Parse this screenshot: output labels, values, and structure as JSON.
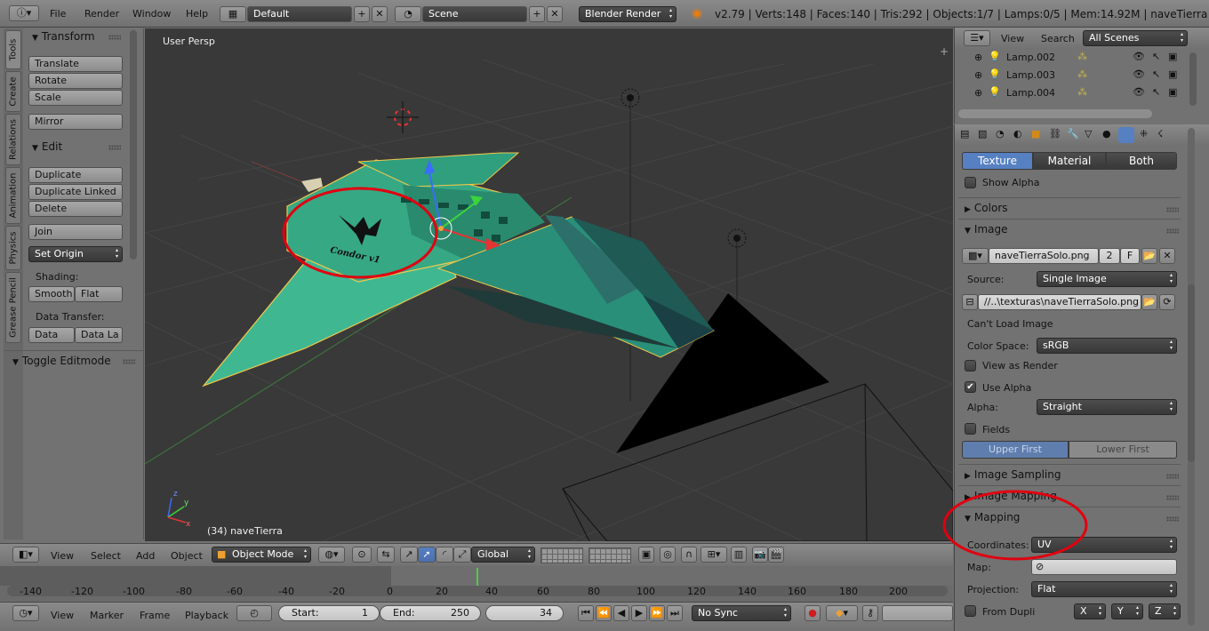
{
  "topbar": {
    "menus": [
      "File",
      "Render",
      "Window",
      "Help"
    ],
    "layout": "Default",
    "scene": "Scene",
    "engine": "Blender Render",
    "info": "v2.79 | Verts:148 | Faces:140 | Tris:292 | Objects:1/7 | Lamps:0/5 | Mem:14.92M | naveTierra"
  },
  "tabs": [
    "Tools",
    "Create",
    "Relations",
    "Animation",
    "Physics",
    "Grease Pencil"
  ],
  "toolshelf": {
    "transform_title": "Transform",
    "translate": "Translate",
    "rotate": "Rotate",
    "scale": "Scale",
    "mirror": "Mirror",
    "edit_title": "Edit",
    "duplicate": "Duplicate",
    "duplicate_linked": "Duplicate Linked",
    "delete": "Delete",
    "join": "Join",
    "set_origin": "Set Origin",
    "shading_label": "Shading:",
    "smooth": "Smooth",
    "flat": "Flat",
    "data_transfer_label": "Data Transfer:",
    "data": "Data",
    "data_la": "Data La",
    "toggle_editmode": "Toggle Editmode"
  },
  "viewport": {
    "view_name": "User Persp",
    "object_label": "(34) naveTierra",
    "decal_text": "Condor v1"
  },
  "vp_header": {
    "menus": [
      "View",
      "Select",
      "Add",
      "Object"
    ],
    "mode": "Object Mode",
    "orientation": "Global"
  },
  "timeline": {
    "ticks": [
      "-140",
      "-120",
      "-100",
      "-80",
      "-60",
      "-40",
      "-20",
      "0",
      "20",
      "40",
      "60",
      "80",
      "100",
      "120",
      "140",
      "160",
      "180",
      "200"
    ],
    "current_frame_marker": 34
  },
  "tl_header": {
    "menus": [
      "View",
      "Marker",
      "Frame",
      "Playback"
    ],
    "start_label": "Start:",
    "start": "1",
    "end_label": "End:",
    "end": "250",
    "current": "34",
    "sync": "No Sync"
  },
  "outliner": {
    "view": "View",
    "search": "Search",
    "filter": "All Scenes",
    "items": [
      "Lamp.002",
      "Lamp.003",
      "Lamp.004"
    ]
  },
  "props": {
    "tabs": [
      "Texture",
      "Material",
      "Both"
    ],
    "show_alpha": "Show Alpha",
    "colors_panel": "Colors",
    "image_panel": "Image",
    "image_name": "naveTierraSolo.png",
    "users": "2",
    "fake": "F",
    "source_label": "Source:",
    "source": "Single Image",
    "filepath": "//..\\texturas\\naveTierraSolo.png",
    "cant_load": "Can't Load Image",
    "color_space_label": "Color Space:",
    "color_space": "sRGB",
    "view_as_render": "View as Render",
    "use_alpha": "Use Alpha",
    "alpha_label": "Alpha:",
    "alpha": "Straight",
    "fields": "Fields",
    "upper_first": "Upper First",
    "lower_first": "Lower First",
    "image_sampling_panel": "Image Sampling",
    "image_mapping_panel": "Image Mapping",
    "mapping_panel": "Mapping",
    "coordinates_label": "Coordinates:",
    "coordinates": "UV",
    "map_label": "Map:",
    "projection_label": "Projection:",
    "projection": "Flat",
    "from_dupli": "From Dupli",
    "x": "X",
    "y": "Y",
    "z": "Z"
  },
  "colors": {
    "accent_blue": "#5680c2",
    "annotation_red": "#e0000f",
    "ship_green": "#35b58f",
    "viewport_bg": "#393939"
  }
}
